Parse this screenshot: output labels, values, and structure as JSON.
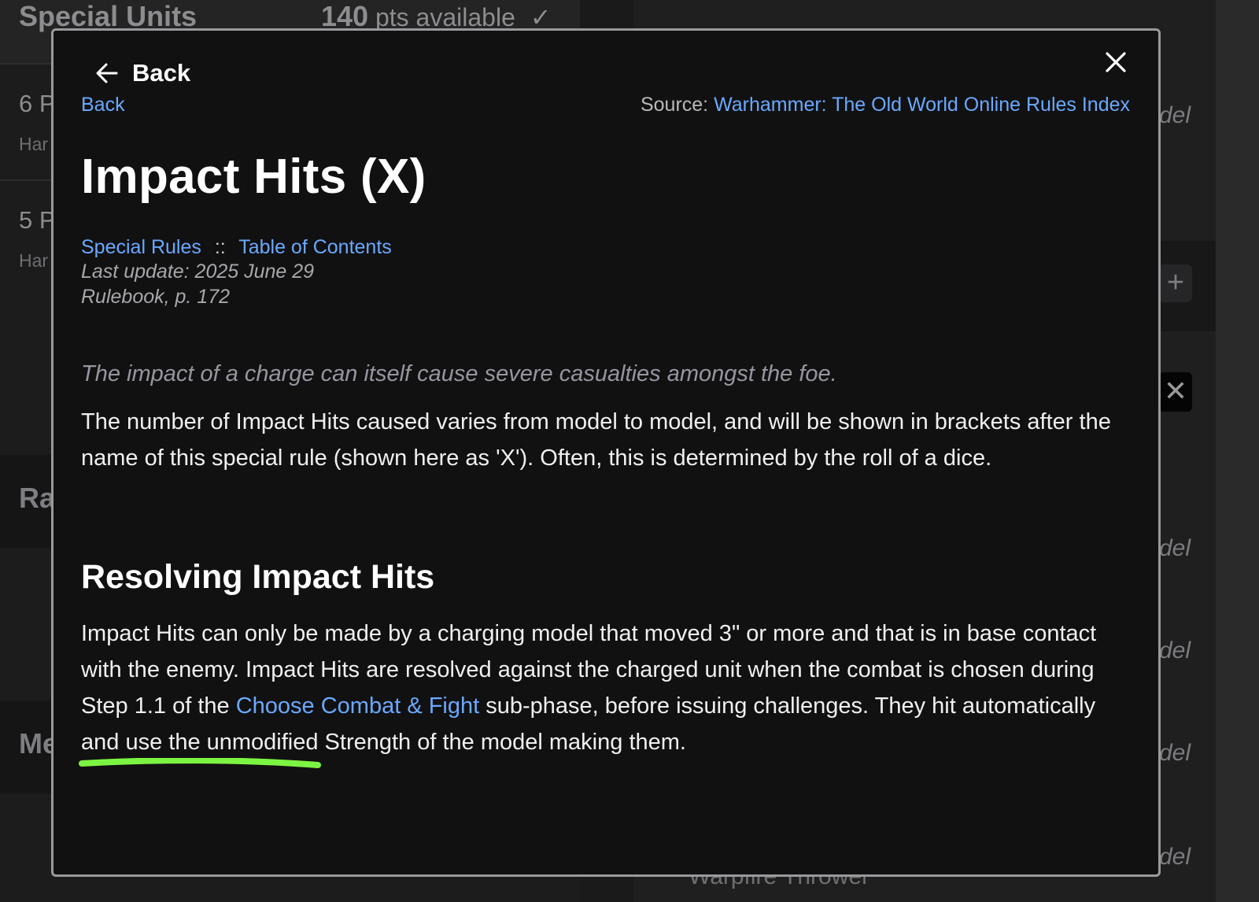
{
  "background": {
    "section_title": "Special Units",
    "points": {
      "value": "140",
      "label": "pts available"
    },
    "rows": [
      {
        "count": "6 P",
        "sub": "Har"
      },
      {
        "count": "5 P",
        "sub": "Har"
      }
    ],
    "sections": [
      "Ra",
      "Me"
    ],
    "model_labels": [
      "del",
      "del",
      "del",
      "del",
      "del"
    ],
    "partial_item": "Warpfire Thrower"
  },
  "modal": {
    "back_button_label": "Back",
    "back_link_label": "Back",
    "source_prefix": "Source:",
    "source_link": "Warhammer: The Old World Online Rules Index",
    "title": "Impact Hits (X)",
    "breadcrumb": {
      "first": "Special Rules",
      "separator": "::",
      "second": "Table of Contents"
    },
    "last_update": "Last update: 2025 June 29",
    "page_ref": "Rulebook, p. 172",
    "flavor_text": "The impact of a charge can itself cause severe casualties amongst the foe.",
    "intro_paragraph": "The number of Impact Hits caused varies from model to model, and will be shown in brackets after the name of this special rule (shown here as 'X'). Often, this is determined by the roll of a dice.",
    "section_heading": "Resolving Impact Hits",
    "resolving": {
      "before_link": "Impact Hits can only be made by a charging model that moved 3\" or more and that is in base contact with the enemy. Impact Hits are resolved against the charged unit when the combat is chosen during Step 1.1 of the ",
      "link": "Choose Combat & Fight",
      "after_link": " sub-phase, before issuing challenges. They hit automatically and use the unmodified Strength of the model making them."
    }
  },
  "colors": {
    "link": "#6aa9ff",
    "modal_bg": "#111112",
    "highlight": "#7cf542"
  }
}
